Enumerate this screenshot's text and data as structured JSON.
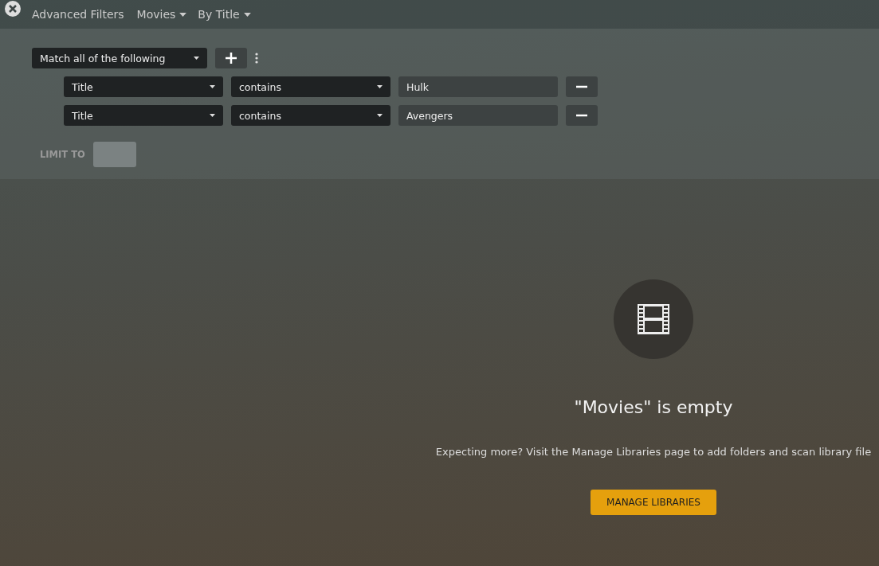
{
  "header": {
    "title": "Advanced Filters",
    "dropdowns": [
      {
        "label": "Movies"
      },
      {
        "label": "By Title"
      }
    ]
  },
  "filter": {
    "match": "Match all of the following",
    "rules": [
      {
        "field": "Title",
        "operator": "contains",
        "value": "Hulk"
      },
      {
        "field": "Title",
        "operator": "contains",
        "value": "Avengers"
      }
    ],
    "limit_label": "LIMIT TO"
  },
  "empty_state": {
    "title": "\"Movies\" is empty",
    "message": "Expecting more? Visit the Manage Libraries page to add folders and scan library file",
    "button": "MANAGE LIBRARIES"
  }
}
